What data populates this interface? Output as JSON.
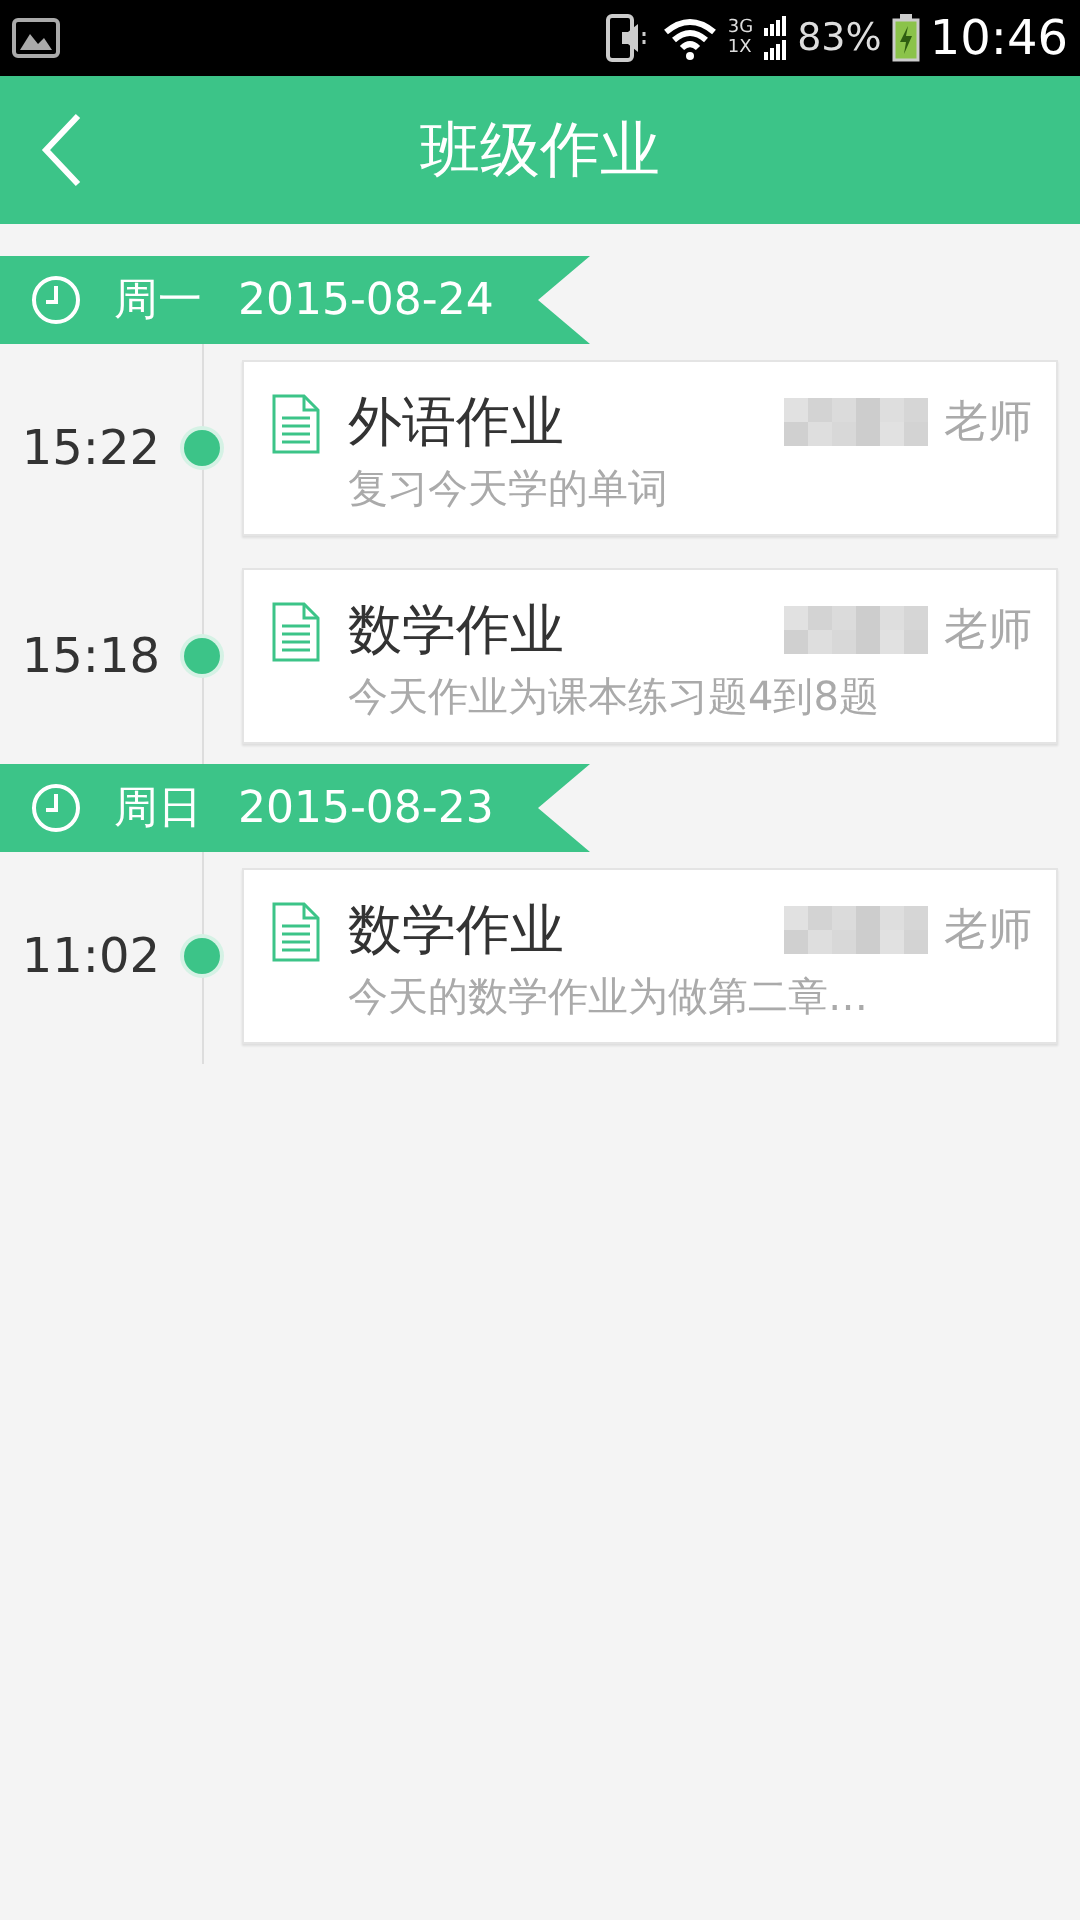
{
  "status_bar": {
    "network_top": "3G",
    "network_bottom": "1X",
    "battery": "83%",
    "time": "10:46"
  },
  "header": {
    "title": "班级作业"
  },
  "days": [
    {
      "weekday": "周一",
      "date": "2015-08-24",
      "entries": [
        {
          "time": "15:22",
          "title": "外语作业",
          "teacher_suffix": "老师",
          "summary": "复习今天学的单词"
        },
        {
          "time": "15:18",
          "title": "数学作业",
          "teacher_suffix": "老师",
          "summary": "今天作业为课本练习题4到8题"
        }
      ]
    },
    {
      "weekday": "周日",
      "date": "2015-08-23",
      "entries": [
        {
          "time": "11:02",
          "title": "数学作业",
          "teacher_suffix": "老师",
          "summary": "今天的数学作业为做第二章…"
        }
      ]
    }
  ]
}
